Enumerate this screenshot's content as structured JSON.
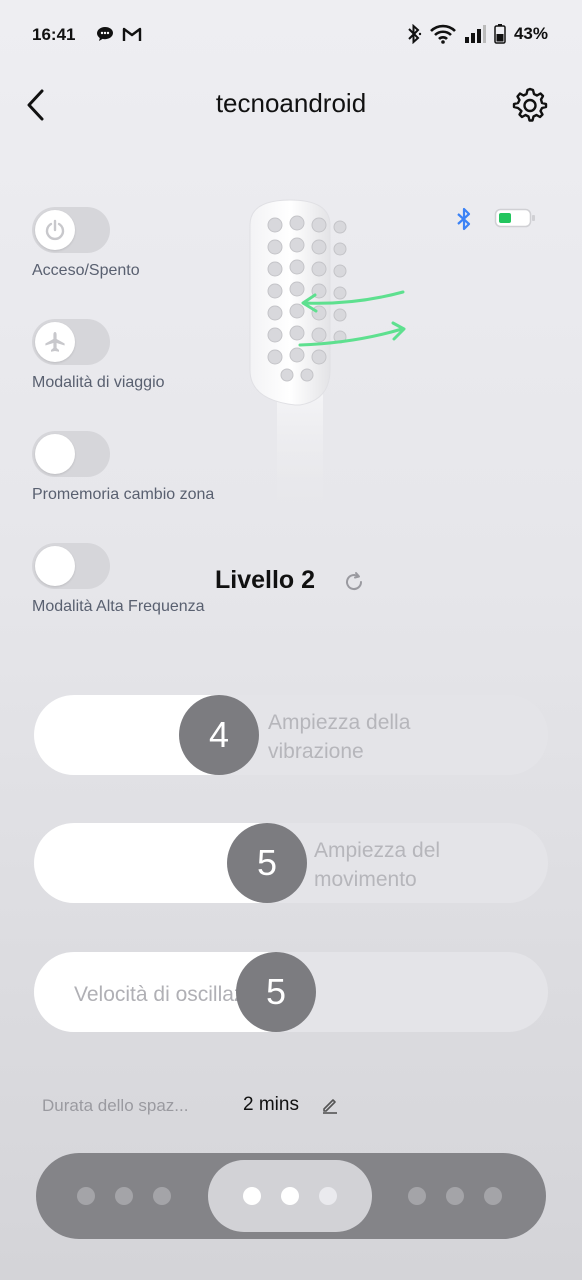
{
  "status_bar": {
    "time": "16:41",
    "battery_percent": "43%",
    "left_icons": [
      "chat-bubble-icon",
      "gmail-icon"
    ],
    "right_icons": [
      "bluetooth-icon",
      "wifi-icon",
      "signal-icon",
      "battery-icon"
    ]
  },
  "header": {
    "title": "tecnoandroid"
  },
  "toggles": [
    {
      "label": "Acceso/Spento",
      "icon": "power-icon",
      "on": false
    },
    {
      "label": "Modalità di viaggio",
      "icon": "airplane-icon",
      "on": false
    },
    {
      "label": "Promemoria cambio zona",
      "icon": "",
      "on": false
    },
    {
      "label": "Modalità Alta Frequenza",
      "icon": "",
      "on": false
    }
  ],
  "device": {
    "bluetooth_color": "#3b82f6",
    "battery_color": "#22c55e"
  },
  "level": {
    "label": "Livello 2"
  },
  "sliders": [
    {
      "value": "4",
      "label_line1": "Ampiezza della",
      "label_line2": "vibrazione"
    },
    {
      "value": "5",
      "label_line1": "Ampiezza del",
      "label_line2": "movimento"
    },
    {
      "value": "5",
      "label": "Velocità di oscillazione"
    }
  ],
  "duration": {
    "label": "Durata dello spaz...",
    "value": "2 mins"
  },
  "modes": {
    "selected_group": 2,
    "groups": 3
  }
}
